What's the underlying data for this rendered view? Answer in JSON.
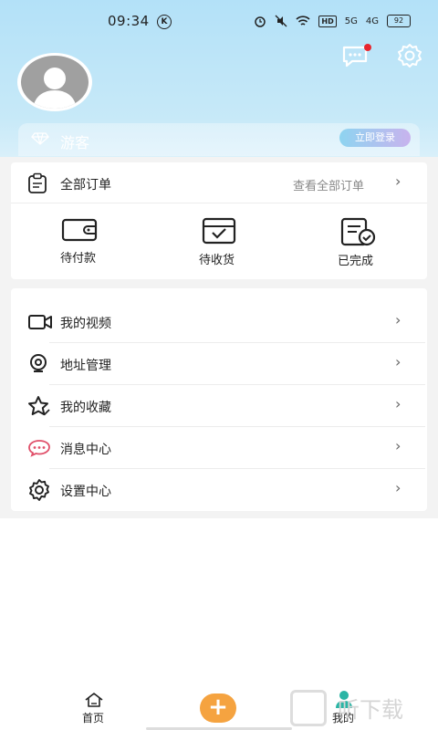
{
  "status_bar": {
    "time": "09:34",
    "network_1": "5G",
    "network_2": "4G",
    "battery": "92",
    "hd_label": "HD"
  },
  "header": {
    "guest_name": "游客",
    "login_button": "立即登录"
  },
  "orders": {
    "title": "全部订单",
    "view_all": "查看全部订单",
    "items": [
      {
        "label": "待付款",
        "icon": "wallet-icon"
      },
      {
        "label": "待收货",
        "icon": "inbox-icon"
      },
      {
        "label": "已完成",
        "icon": "completed-doc-icon"
      }
    ]
  },
  "menu": {
    "items": [
      {
        "label": "我的视频",
        "icon": "video-icon"
      },
      {
        "label": "地址管理",
        "icon": "location-icon"
      },
      {
        "label": "我的收藏",
        "icon": "star-icon"
      },
      {
        "label": "消息中心",
        "icon": "message-icon"
      },
      {
        "label": "设置中心",
        "icon": "settings-icon"
      }
    ]
  },
  "bottom_nav": {
    "home": "首页",
    "add": "+",
    "mine": "我的"
  },
  "watermark": "听下载",
  "colors": {
    "header_bg": "#b3e1f8",
    "accent_orange": "#f5a340",
    "notify_red": "#e8262e",
    "message_icon": "#e0506a"
  }
}
